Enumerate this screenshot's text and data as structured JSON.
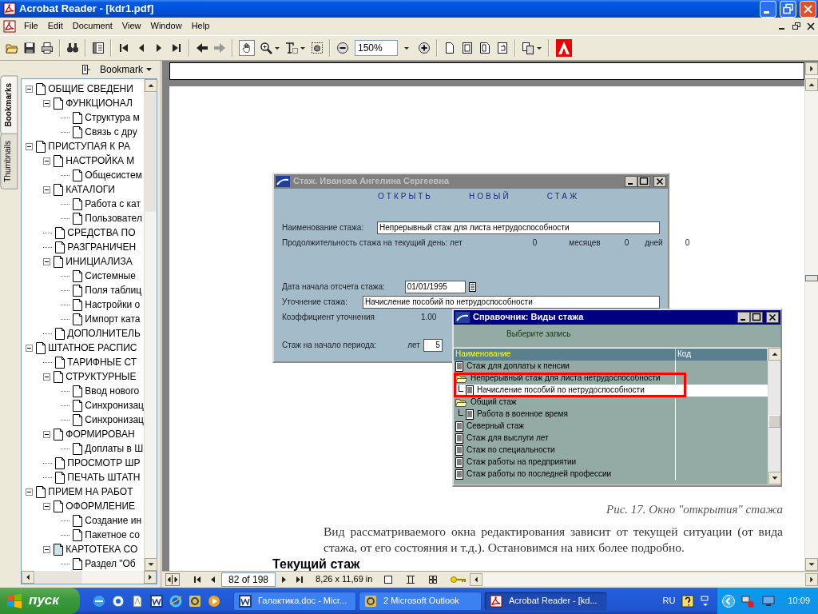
{
  "window": {
    "title": "Acrobat Reader - [kdr1.pdf]"
  },
  "menu": [
    "File",
    "Edit",
    "Document",
    "View",
    "Window",
    "Help"
  ],
  "toolbar": {
    "zoom": "150%"
  },
  "nav_pane": {
    "tabs": [
      {
        "label": "Bookmarks",
        "selected": true
      },
      {
        "label": "Thumbnails",
        "selected": false
      }
    ],
    "menu_label": "Bookmark",
    "bookmarks": [
      {
        "label": "ОБЩИЕ СВЕДЕНИ",
        "expanded": true,
        "current": false,
        "children": [
          {
            "label": "ФУНКЦИОНАЛ",
            "expanded": true,
            "current": false,
            "children": [
              {
                "label": "Структура м",
                "current": false
              },
              {
                "label": "Связь с дру",
                "current": false
              }
            ]
          }
        ]
      },
      {
        "label": "ПРИСТУПАЯ К РА",
        "expanded": true,
        "current": false,
        "children": [
          {
            "label": "НАСТРОЙКА М",
            "expanded": true,
            "current": false,
            "children": [
              {
                "label": "Общесистем",
                "current": false
              }
            ]
          },
          {
            "label": "КАТАЛОГИ",
            "expanded": true,
            "current": false,
            "children": [
              {
                "label": "Работа с кат",
                "current": false
              },
              {
                "label": "Пользовател",
                "current": false
              }
            ]
          },
          {
            "label": "СРЕДСТВА ПО",
            "current": false
          },
          {
            "label": "РАЗГРАНИЧЕН",
            "current": false
          },
          {
            "label": "ИНИЦИАЛИЗА",
            "expanded": true,
            "current": false,
            "children": [
              {
                "label": "Системные",
                "current": false
              },
              {
                "label": "Поля таблиц",
                "current": false
              },
              {
                "label": "Настройки о",
                "current": false
              },
              {
                "label": "Импорт ката",
                "current": false
              }
            ]
          },
          {
            "label": "ДОПОЛНИТЕЛЬ",
            "current": false
          }
        ]
      },
      {
        "label": "ШТАТНОЕ РАСПИС",
        "expanded": true,
        "current": false,
        "children": [
          {
            "label": "ТАРИФНЫЕ СТ",
            "current": false
          },
          {
            "label": "СТРУКТУРНЫЕ",
            "expanded": true,
            "current": false,
            "children": [
              {
                "label": "Ввод нового",
                "current": false
              },
              {
                "label": "Синхронизац",
                "current": false
              },
              {
                "label": "Синхронизац",
                "current": false
              }
            ]
          },
          {
            "label": "ФОРМИРОВАН",
            "expanded": true,
            "current": false,
            "children": [
              {
                "label": "Доплаты в Ш",
                "current": false
              }
            ]
          },
          {
            "label": "ПРОСМОТР ШР",
            "current": false
          },
          {
            "label": "ПЕЧАТЬ ШТАТН",
            "current": false
          }
        ]
      },
      {
        "label": "ПРИЕМ НА РАБОТ",
        "expanded": true,
        "current": false,
        "children": [
          {
            "label": "ОФОРМЛЕНИЕ",
            "expanded": true,
            "current": false,
            "children": [
              {
                "label": "Создание ин",
                "current": false
              },
              {
                "label": "Пакетное со",
                "current": false
              }
            ]
          },
          {
            "label": "КАРТОТЕКА СО",
            "expanded": true,
            "current": true,
            "children": [
              {
                "label": "Раздел \"Об",
                "current": false
              }
            ]
          }
        ]
      }
    ]
  },
  "document": {
    "record_window": {
      "title": "Стаж. Иванова Ангелина Сергеевна",
      "active": false,
      "actions": [
        "ОТКРЫТЬ",
        "НОВЫЙ",
        "СТАЖ"
      ],
      "name_label": "Наименование стажа:",
      "name_value": "Непрерывный стаж для листа нетрудоспособности",
      "duration_label": "Продолжительность стажа на текущий день: лет",
      "years": "0",
      "months_label": "месяцев",
      "months": "0",
      "days_label": "дней",
      "days": "0",
      "start_label": "Дата начала отсчета стажа:",
      "start_value": "01/01/1995",
      "refine_label": "Уточнение стажа:",
      "refine_value": "Начисление пособий по нетрудоспособности",
      "coef_label": "Коэффициент уточнения",
      "coef": "1.00",
      "period_label": "Стаж на начало периода:",
      "period_years_label": "лет",
      "period_years": "5"
    },
    "lookup_window": {
      "title": "Справочник: Виды стажа",
      "active": true,
      "prompt": "Выберите запись",
      "columns": [
        "Наименование",
        "Код"
      ],
      "rows": [
        {
          "kind": "doc",
          "name": "Стаж для доплаты к пенсии",
          "selected": false,
          "boxed": false
        },
        {
          "kind": "folder",
          "name": "Непрерывный стаж для листа нетрудоспособности",
          "selected": false,
          "boxed": true,
          "children": [
            {
              "kind": "doc",
              "name": "Начисление пособий по нетрудоспособности",
              "selected": true,
              "boxed": false
            }
          ]
        },
        {
          "kind": "folder",
          "name": "Общий стаж",
          "selected": false,
          "boxed": false,
          "children": [
            {
              "kind": "doc",
              "name": "Работа в военное время",
              "selected": false,
              "boxed": false
            }
          ]
        },
        {
          "kind": "doc",
          "name": "Северный стаж",
          "selected": false,
          "boxed": false
        },
        {
          "kind": "doc",
          "name": "Стаж для выслуги лет",
          "selected": false,
          "boxed": false
        },
        {
          "kind": "doc",
          "name": "Стаж по специальности",
          "selected": false,
          "boxed": false
        },
        {
          "kind": "doc",
          "name": "Стаж работы на предприятии",
          "selected": false,
          "boxed": false
        },
        {
          "kind": "doc",
          "name": "Стаж работы по последней профессии",
          "selected": false,
          "boxed": false
        }
      ]
    },
    "caption": "Рис. 17. Окно \"открытия\" стажа",
    "paragraph": "Вид рассматриваемого окна редактирования зависит от текущей ситуации (от вида стажа, от его состояния и т.д.). Остановимся на них более подробно.",
    "heading": "Текущий стаж"
  },
  "status_bar": {
    "page": "82 of 198",
    "page_size": "8,26 x 11,69 in"
  },
  "taskbar": {
    "start": "пуск",
    "tasks": [
      {
        "label": "Галактика.doc - Micr...",
        "selected": false,
        "kind": "word"
      },
      {
        "label": "2 Microsoft Outlook",
        "selected": false,
        "kind": "outlook"
      },
      {
        "label": "Acrobat Reader - [kd...",
        "selected": true,
        "kind": "acrobat"
      }
    ],
    "language": "RU",
    "clock": "10:09"
  }
}
